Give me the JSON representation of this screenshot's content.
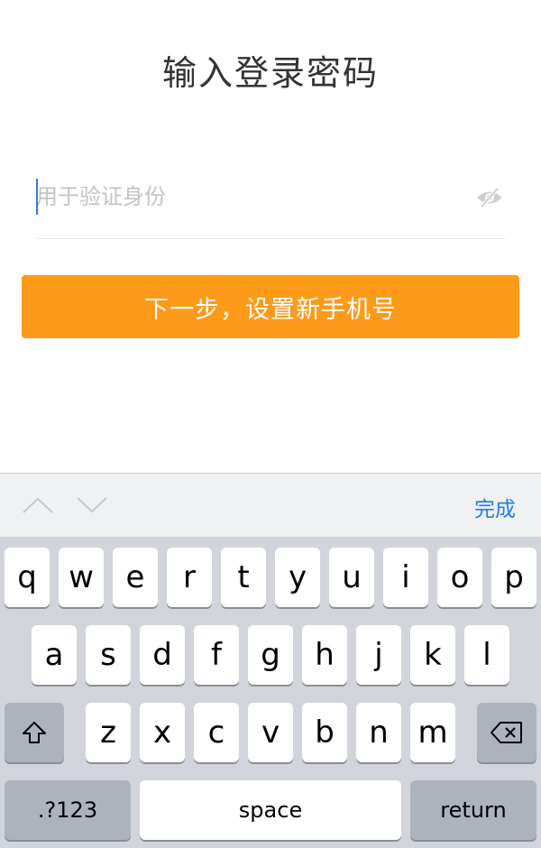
{
  "title": "输入登录密码",
  "password_field": {
    "placeholder": "用于验证身份",
    "value": "",
    "toggle_icon": "eye-slash-icon"
  },
  "primary_button": {
    "label": "下一步，设置新手机号",
    "color": "#fd9a1a"
  },
  "keyboard_accessory": {
    "prev_icon": "chevron-up-icon",
    "next_icon": "chevron-down-icon",
    "done_label": "完成",
    "done_color": "#1f7de8"
  },
  "keyboard": {
    "row1": [
      "q",
      "w",
      "e",
      "r",
      "t",
      "y",
      "u",
      "i",
      "o",
      "p"
    ],
    "row2": [
      "a",
      "s",
      "d",
      "f",
      "g",
      "h",
      "j",
      "k",
      "l"
    ],
    "row3": [
      "z",
      "x",
      "c",
      "v",
      "b",
      "n",
      "m"
    ],
    "shift_icon": "shift-icon",
    "delete_icon": "backspace-icon",
    "numbers_label": ".?123",
    "space_label": "space",
    "return_label": "return"
  }
}
